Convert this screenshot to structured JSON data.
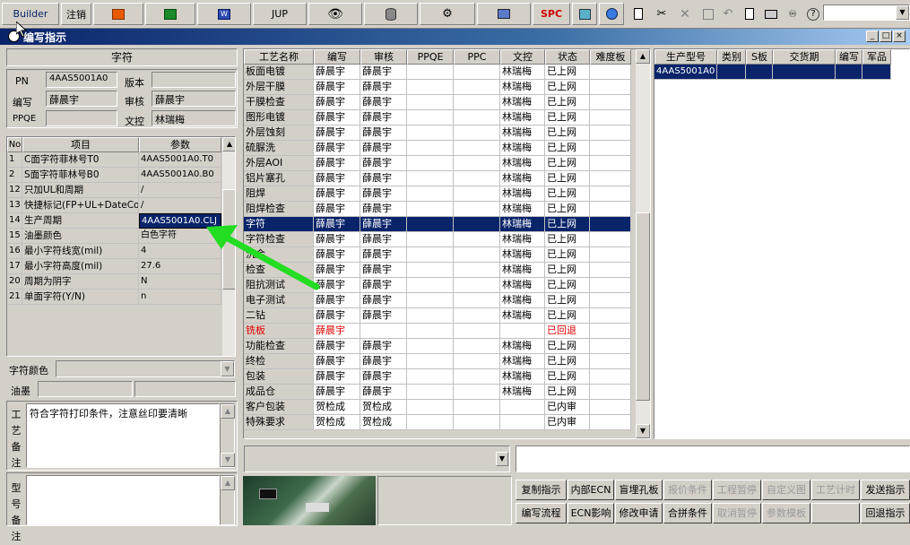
{
  "toolbar": {
    "builder_label": "Builder",
    "logout_label": "注销",
    "jup_label": "JUP",
    "spc_label": "SPC"
  },
  "window": {
    "title": "编写指示"
  },
  "left": {
    "section_title": "字符",
    "pn_label": "PN",
    "pn_value": "4AAS5001A0",
    "version_label": "版本",
    "version_value": "",
    "author_label": "编写",
    "author_value": "薛晨宇",
    "reviewer_label": "审核",
    "reviewer_value": "薛晨宇",
    "ppqe_label": "PPQE",
    "ppqe_value": "",
    "dc_label": "文控",
    "dc_value": "林瑞梅",
    "param_headers": {
      "no": "No",
      "item": "项目",
      "param": "参数"
    },
    "params": [
      {
        "no": "1",
        "item": "C面字符菲林号T0",
        "value": "4AAS5001A0.T0"
      },
      {
        "no": "2",
        "item": "S面字符菲林号B0",
        "value": "4AAS5001A0.B0"
      },
      {
        "no": "12",
        "item": "只加UL和周期",
        "value": "/"
      },
      {
        "no": "13",
        "item": "快捷标记(FP+UL+DateCo",
        "value": "/"
      },
      {
        "no": "14",
        "item": "生产周期",
        "value": "4AAS5001A0.CLJ"
      },
      {
        "no": "15",
        "item": "油墨颜色",
        "value": "白色字符"
      },
      {
        "no": "16",
        "item": "最小字符线宽(mil)",
        "value": "4"
      },
      {
        "no": "17",
        "item": "最小字符高度(mil)",
        "value": "27.6"
      },
      {
        "no": "20",
        "item": "周期为阴字",
        "value": "N"
      },
      {
        "no": "21",
        "item": "单面字符(Y/N)",
        "value": "n"
      }
    ],
    "char_color_label": "字符颜色",
    "ink_label": "油墨",
    "process_note_label": "工艺备注",
    "process_note_text": "符合字符打印条件，注意丝印要清晰",
    "model_note_label": "型号备注"
  },
  "middle": {
    "headers": [
      "工艺名称",
      "编写",
      "审核",
      "PPQE",
      "PPC",
      "文控",
      "状态",
      "难度板"
    ],
    "rows": [
      [
        "板面电镀",
        "薛晨宇",
        "薛晨宇",
        "",
        "",
        "林瑞梅",
        "已上网",
        ""
      ],
      [
        "外层干膜",
        "薛晨宇",
        "薛晨宇",
        "",
        "",
        "林瑞梅",
        "已上网",
        ""
      ],
      [
        "干膜检查",
        "薛晨宇",
        "薛晨宇",
        "",
        "",
        "林瑞梅",
        "已上网",
        ""
      ],
      [
        "图形电镀",
        "薛晨宇",
        "薛晨宇",
        "",
        "",
        "林瑞梅",
        "已上网",
        ""
      ],
      [
        "外层蚀刻",
        "薛晨宇",
        "薛晨宇",
        "",
        "",
        "林瑞梅",
        "已上网",
        ""
      ],
      [
        "硫脲洗",
        "薛晨宇",
        "薛晨宇",
        "",
        "",
        "林瑞梅",
        "已上网",
        ""
      ],
      [
        "外层AOI",
        "薛晨宇",
        "薛晨宇",
        "",
        "",
        "林瑞梅",
        "已上网",
        ""
      ],
      [
        "铝片塞孔",
        "薛晨宇",
        "薛晨宇",
        "",
        "",
        "林瑞梅",
        "已上网",
        ""
      ],
      [
        "阻焊",
        "薛晨宇",
        "薛晨宇",
        "",
        "",
        "林瑞梅",
        "已上网",
        ""
      ],
      [
        "阻焊检查",
        "薛晨宇",
        "薛晨宇",
        "",
        "",
        "林瑞梅",
        "已上网",
        ""
      ],
      [
        "字符",
        "薛晨宇",
        "薛晨宇",
        "",
        "",
        "林瑞梅",
        "已上网",
        ""
      ],
      [
        "字符检查",
        "薛晨宇",
        "薛晨宇",
        "",
        "",
        "林瑞梅",
        "已上网",
        ""
      ],
      [
        "沉金",
        "薛晨宇",
        "薛晨宇",
        "",
        "",
        "林瑞梅",
        "已上网",
        ""
      ],
      [
        "检查",
        "薛晨宇",
        "薛晨宇",
        "",
        "",
        "林瑞梅",
        "已上网",
        ""
      ],
      [
        "阻抗测试",
        "薛晨宇",
        "薛晨宇",
        "",
        "",
        "林瑞梅",
        "已上网",
        ""
      ],
      [
        "电子测试",
        "薛晨宇",
        "薛晨宇",
        "",
        "",
        "林瑞梅",
        "已上网",
        ""
      ],
      [
        "二钻",
        "薛晨宇",
        "薛晨宇",
        "",
        "",
        "林瑞梅",
        "已上网",
        ""
      ],
      [
        "铣板",
        "薛晨宇",
        "",
        "",
        "",
        "",
        "已回退",
        ""
      ],
      [
        "功能检查",
        "薛晨宇",
        "薛晨宇",
        "",
        "",
        "林瑞梅",
        "已上网",
        ""
      ],
      [
        "终检",
        "薛晨宇",
        "薛晨宇",
        "",
        "",
        "林瑞梅",
        "已上网",
        ""
      ],
      [
        "包装",
        "薛晨宇",
        "薛晨宇",
        "",
        "",
        "林瑞梅",
        "已上网",
        ""
      ],
      [
        "成品仓",
        "薛晨宇",
        "薛晨宇",
        "",
        "",
        "林瑞梅",
        "已上网",
        ""
      ],
      [
        "客户包装",
        "贺检成",
        "贺检成",
        "",
        "",
        "",
        "已内审",
        ""
      ],
      [
        "特殊要求",
        "贺检成",
        "贺检成",
        "",
        "",
        "",
        "已内审",
        ""
      ]
    ],
    "selected_row": 10,
    "returned_row": 17,
    "returned_color": "#e00000",
    "selected_bg": "#0a246a"
  },
  "right": {
    "headers": [
      "生产型号",
      "类别",
      "S板",
      "交货期",
      "编写",
      "军品"
    ],
    "rows": [
      [
        "4AAS5001A0",
        "",
        "",
        "",
        "",
        ""
      ]
    ]
  },
  "buttons": {
    "row1": [
      {
        "label": "复制指示",
        "enabled": true
      },
      {
        "label": "内部ECN",
        "enabled": true
      },
      {
        "label": "盲埋孔板",
        "enabled": true
      },
      {
        "label": "报价条件",
        "enabled": false
      },
      {
        "label": "工程暂停",
        "enabled": false
      },
      {
        "label": "自定义图",
        "enabled": false
      },
      {
        "label": "工艺计时",
        "enabled": false
      },
      {
        "label": "发送指示",
        "enabled": true
      }
    ],
    "row2": [
      {
        "label": "编写流程",
        "enabled": true
      },
      {
        "label": "ECN影响",
        "enabled": true
      },
      {
        "label": "修改申请",
        "enabled": true
      },
      {
        "label": "合拼条件",
        "enabled": true
      },
      {
        "label": "取消暂停",
        "enabled": false
      },
      {
        "label": "参数模板",
        "enabled": false
      },
      {
        "label": "",
        "enabled": false
      },
      {
        "label": "回退指示",
        "enabled": true
      }
    ]
  },
  "colors": {
    "arrow": "#22dd22",
    "title_bar": "#0a246a"
  }
}
